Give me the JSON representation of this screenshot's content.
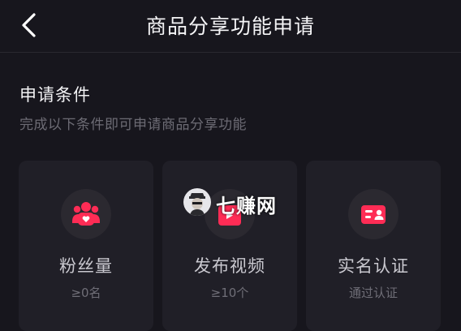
{
  "header": {
    "title": "商品分享功能申请",
    "back_icon": "chevron-left-icon"
  },
  "section": {
    "title": "申请条件",
    "subtitle": "完成以下条件即可申请商品分享功能"
  },
  "cards": [
    {
      "label": "粉丝量",
      "sub": "≥0名",
      "icon": "fans-icon"
    },
    {
      "label": "发布视频",
      "sub": "≥10个",
      "icon": "video-icon"
    },
    {
      "label": "实名认证",
      "sub": "通过认证",
      "icon": "id-card-icon"
    }
  ],
  "watermark": {
    "text": "七赚网"
  },
  "colors": {
    "accent": "#fe2c55",
    "background": "#17161d",
    "card": "#201f27"
  }
}
